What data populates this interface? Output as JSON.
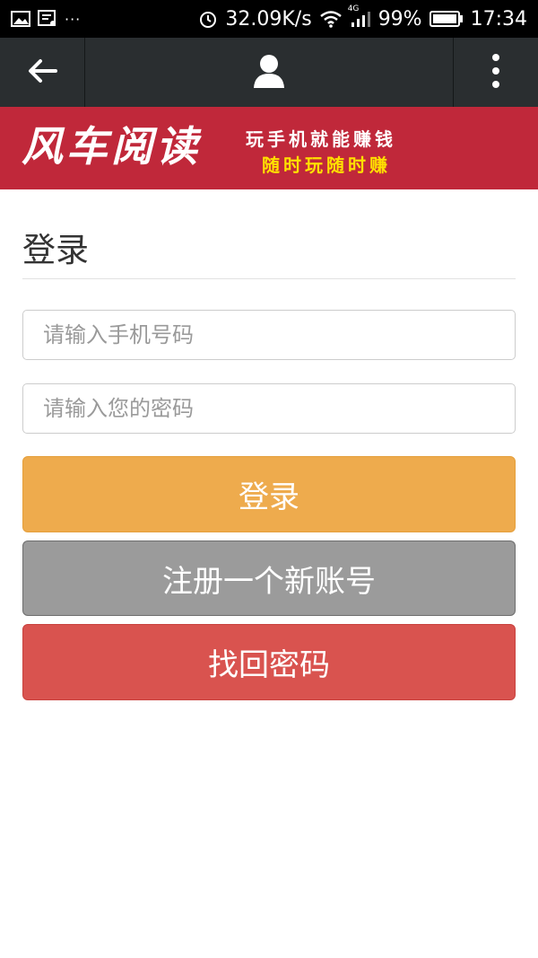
{
  "status_bar": {
    "dots": "···",
    "net_speed": "32.09K/s",
    "network": "4G",
    "battery": "99%",
    "time": "17:34",
    "icons": [
      "image-icon",
      "message-icon",
      "alarm-icon",
      "wifi-icon",
      "signal-icon",
      "battery-icon"
    ]
  },
  "top_bar": {
    "icons": [
      "back-arrow-icon",
      "user-icon",
      "more-vertical-icon"
    ]
  },
  "banner": {
    "logo": "风车阅读",
    "slogan_line1": "玩手机就能赚钱",
    "slogan_line2": "随时玩随时赚"
  },
  "login": {
    "title": "登录",
    "phone_placeholder": "请输入手机号码",
    "password_placeholder": "请输入您的密码",
    "login_button": "登录",
    "register_button": "注册一个新账号",
    "forgot_button": "找回密码"
  },
  "colors": {
    "banner_bg": "#c0283a",
    "top_bar_bg": "#2a2e30",
    "login_btn": "#eeab4d",
    "register_btn": "#9b9b9b",
    "forgot_btn": "#d9534f",
    "slogan_highlight": "#ffe000"
  }
}
